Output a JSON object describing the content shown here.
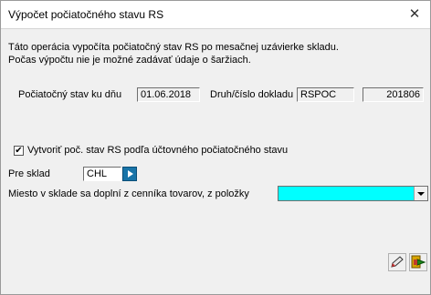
{
  "window": {
    "title": "Výpočet počiatočného stavu RS",
    "close_glyph": "✕"
  },
  "info": {
    "line1": "Táto operácia vypočíta počiatočný stav RS po mesačnej uzávierke skladu.",
    "line2": "Počas výpočtu nie je možné zadávať údaje o šaržiach."
  },
  "state": {
    "date_label": "Počiatočný stav ku dňu",
    "date_value": "01.06.2018",
    "doc_label": "Druh/číslo dokladu",
    "doc_type": "RSPOC",
    "doc_number": "201806"
  },
  "options": {
    "create_check_label": "Vytvoriť poč. stav RS podľa účtovného počiatočného stavu",
    "create_checked": true,
    "check_glyph": "✔",
    "warehouse_label": "Pre sklad",
    "warehouse_value": "CHL",
    "location_label": "Miesto v sklade sa doplní z cenníka tovarov, z položky",
    "location_value": "",
    "location_color": "#00ffff"
  },
  "toolbar": {
    "icons": [
      "edit-pen-icon",
      "run-exit-icon"
    ]
  },
  "colors": {
    "go_button": "#1874a8",
    "panel": "#f0f0f0"
  }
}
